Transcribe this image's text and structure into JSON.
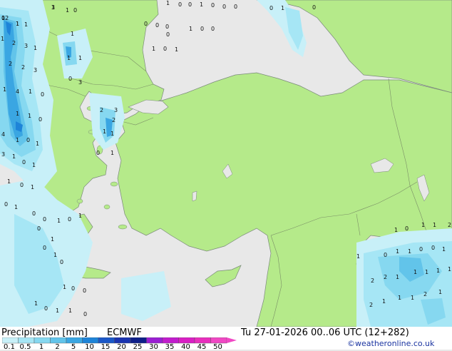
{
  "footer": {
    "title_left": "Precipitation [mm]",
    "model": "ECMWF",
    "valid_time": "Tu 27-01-2026 00..06 UTC (12+282)",
    "copyright": "©weatheronline.co.uk"
  },
  "scale": {
    "values": [
      "0.1",
      "0.5",
      "1",
      "2",
      "5",
      "10",
      "15",
      "20",
      "25",
      "30",
      "35",
      "40",
      "45",
      "50"
    ],
    "colors": [
      "#c8f0f8",
      "#a6e6f5",
      "#86d8f0",
      "#62c4ea",
      "#3aa6e2",
      "#1e84d8",
      "#1b58c8",
      "#1a34b0",
      "#0e1f88",
      "#9a1fd2",
      "#c21ccd",
      "#d91fc4",
      "#e82ebd",
      "#f048c4"
    ]
  },
  "colors": {
    "land": "#b5ea8a",
    "sea": "#e8e8e8",
    "border": "#7a8f66",
    "coast": "#7a8a7a"
  },
  "map_values": [
    "12",
    "1",
    "3",
    "1",
    "0",
    "1",
    "1",
    "1",
    "0",
    "0",
    "1",
    "0",
    "0",
    "0",
    "0",
    "1",
    "0",
    "0",
    "0",
    "0",
    "1",
    "0",
    "0",
    "0",
    "1",
    "0",
    "1",
    "1",
    "2",
    "3",
    "1",
    "2",
    "2",
    "3",
    "1",
    "4",
    "1",
    "0",
    "1",
    "1",
    "0",
    "3",
    "1",
    "1",
    "0",
    "2",
    "3",
    "2",
    "4",
    "1",
    "0",
    "1",
    "3",
    "1",
    "0",
    "1",
    "1",
    "1",
    "0",
    "1",
    "1",
    "0",
    "1",
    "0",
    "1",
    "0",
    "0",
    "1",
    "0",
    "1",
    "0",
    "1",
    "0",
    "1",
    "0",
    "1",
    "0",
    "0",
    "1",
    "0",
    "1",
    "1",
    "0",
    "1",
    "0",
    "1",
    "1",
    "0",
    "0",
    "1",
    "1",
    "0",
    "1",
    "1",
    "2",
    "2",
    "2",
    "1",
    "1",
    "1",
    "1",
    "1",
    "2",
    "1",
    "1",
    "1",
    "2",
    "1",
    "0",
    "1",
    "1"
  ]
}
